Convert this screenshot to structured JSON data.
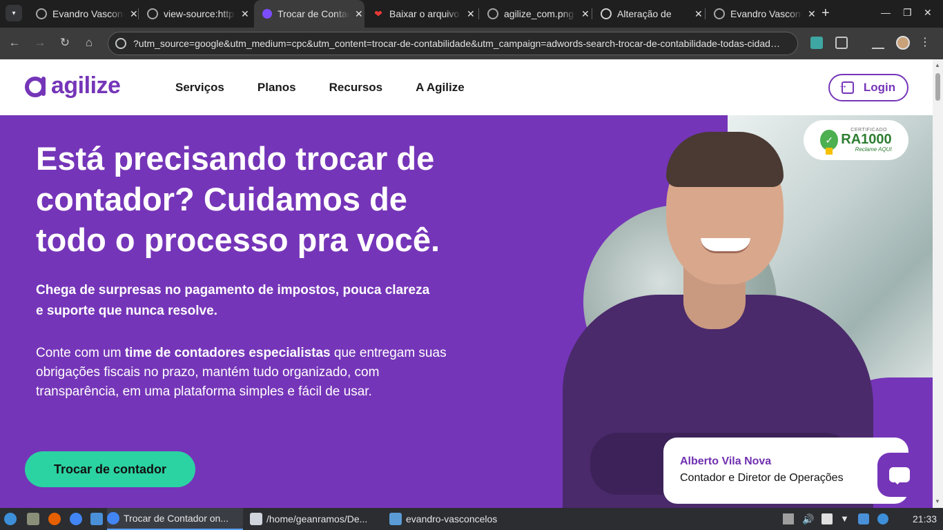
{
  "browser": {
    "tabs": [
      {
        "label": "Evandro Vasconcelos",
        "icon": "globe-icon"
      },
      {
        "label": "view-source:https://",
        "icon": "globe-icon"
      },
      {
        "label": "Trocar de Contador",
        "icon": "agilize-icon",
        "active": true
      },
      {
        "label": "Baixar o arquivo",
        "icon": "heart-icon"
      },
      {
        "label": "agilize_com.png",
        "icon": "globe-icon"
      },
      {
        "label": "Alteração de",
        "icon": "chatgpt-icon"
      },
      {
        "label": "Evandro Vasconcelos",
        "icon": "globe-icon"
      }
    ],
    "url": "?utm_source=google&utm_medium=cpc&utm_content=trocar-de-contabilidade&utm_campaign=adwords-search-trocar-de-contabilidade-todas-cidad…"
  },
  "site": {
    "logo_text": "agilize",
    "nav": [
      "Serviços",
      "Planos",
      "Recursos",
      "A Agilize"
    ],
    "login_label": "Login",
    "badge": {
      "certificate": "CERTIFICADO",
      "ra": "RA1000",
      "reclame": "Reclame AQUI"
    },
    "headline": "Está precisando trocar de contador? Cuidamos de todo o processo pra você.",
    "sub1": "Chega de surpresas no pagamento de impostos, pouca clareza e suporte que nunca resolve.",
    "sub2_pre": "Conte com um ",
    "sub2_bold": "time de contadores especialistas",
    "sub2_post": " que entregam suas obrigações fiscais no prazo, mantém tudo organizado, com transparência, em uma plataforma simples e fácil de usar.",
    "cta_label": "Trocar de contador",
    "person_name": "Alberto Vila Nova",
    "person_role": "Contador e Diretor de Operações"
  },
  "taskbar": {
    "items": [
      {
        "label": "Trocar de Contador on...",
        "icon": "chrome-icon",
        "active": true
      },
      {
        "label": "/home/geanramos/De...",
        "icon": "editor-icon"
      },
      {
        "label": "evandro-vasconcelos",
        "icon": "folder-icon"
      }
    ],
    "clock": "21:33"
  },
  "colors": {
    "brand": "#7535b8",
    "cta": "#2bd3a2"
  }
}
